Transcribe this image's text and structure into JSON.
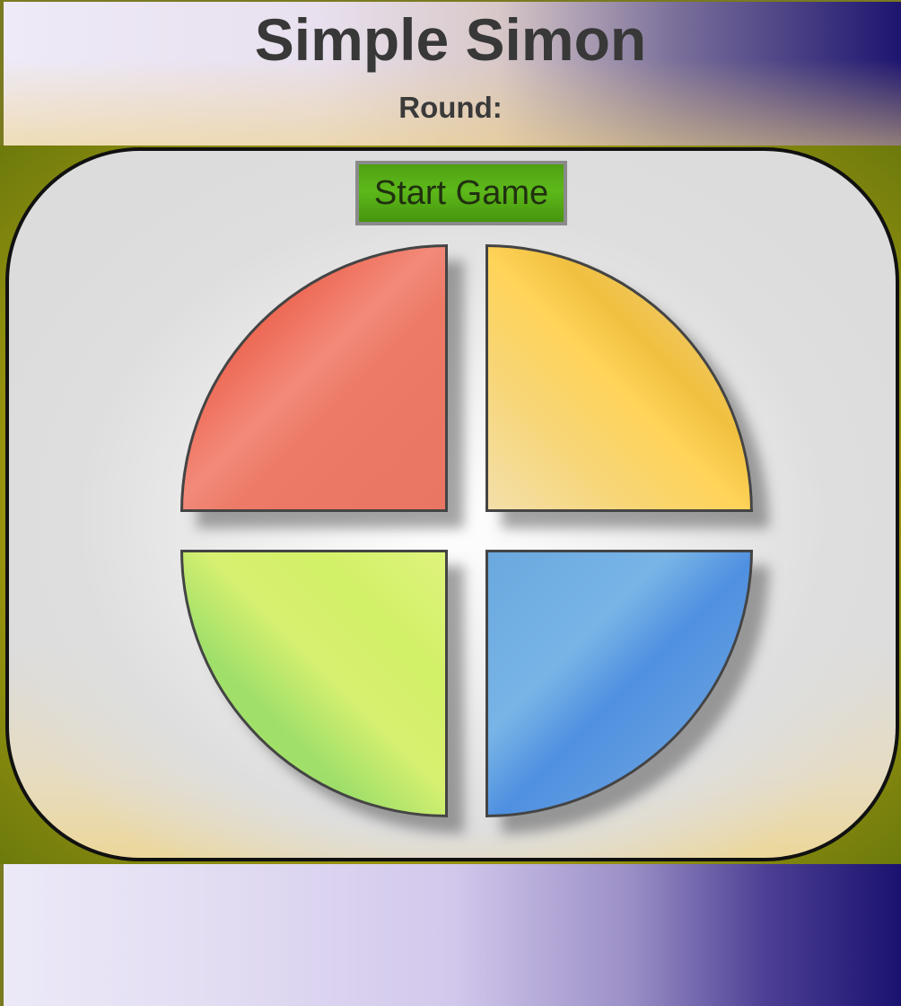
{
  "header": {
    "title": "Simple Simon",
    "round_label": "Round:"
  },
  "controls": {
    "start_label": "Start Game"
  },
  "pads": [
    {
      "name": "red",
      "color": "#ee6a55"
    },
    {
      "name": "yellow",
      "color": "#f0c040"
    },
    {
      "name": "green",
      "color": "#a6e46a"
    },
    {
      "name": "blue",
      "color": "#5f9be0"
    }
  ],
  "colors": {
    "board_border": "#111111",
    "button_green": "#5db91a",
    "page_accent": "#1a1370"
  }
}
